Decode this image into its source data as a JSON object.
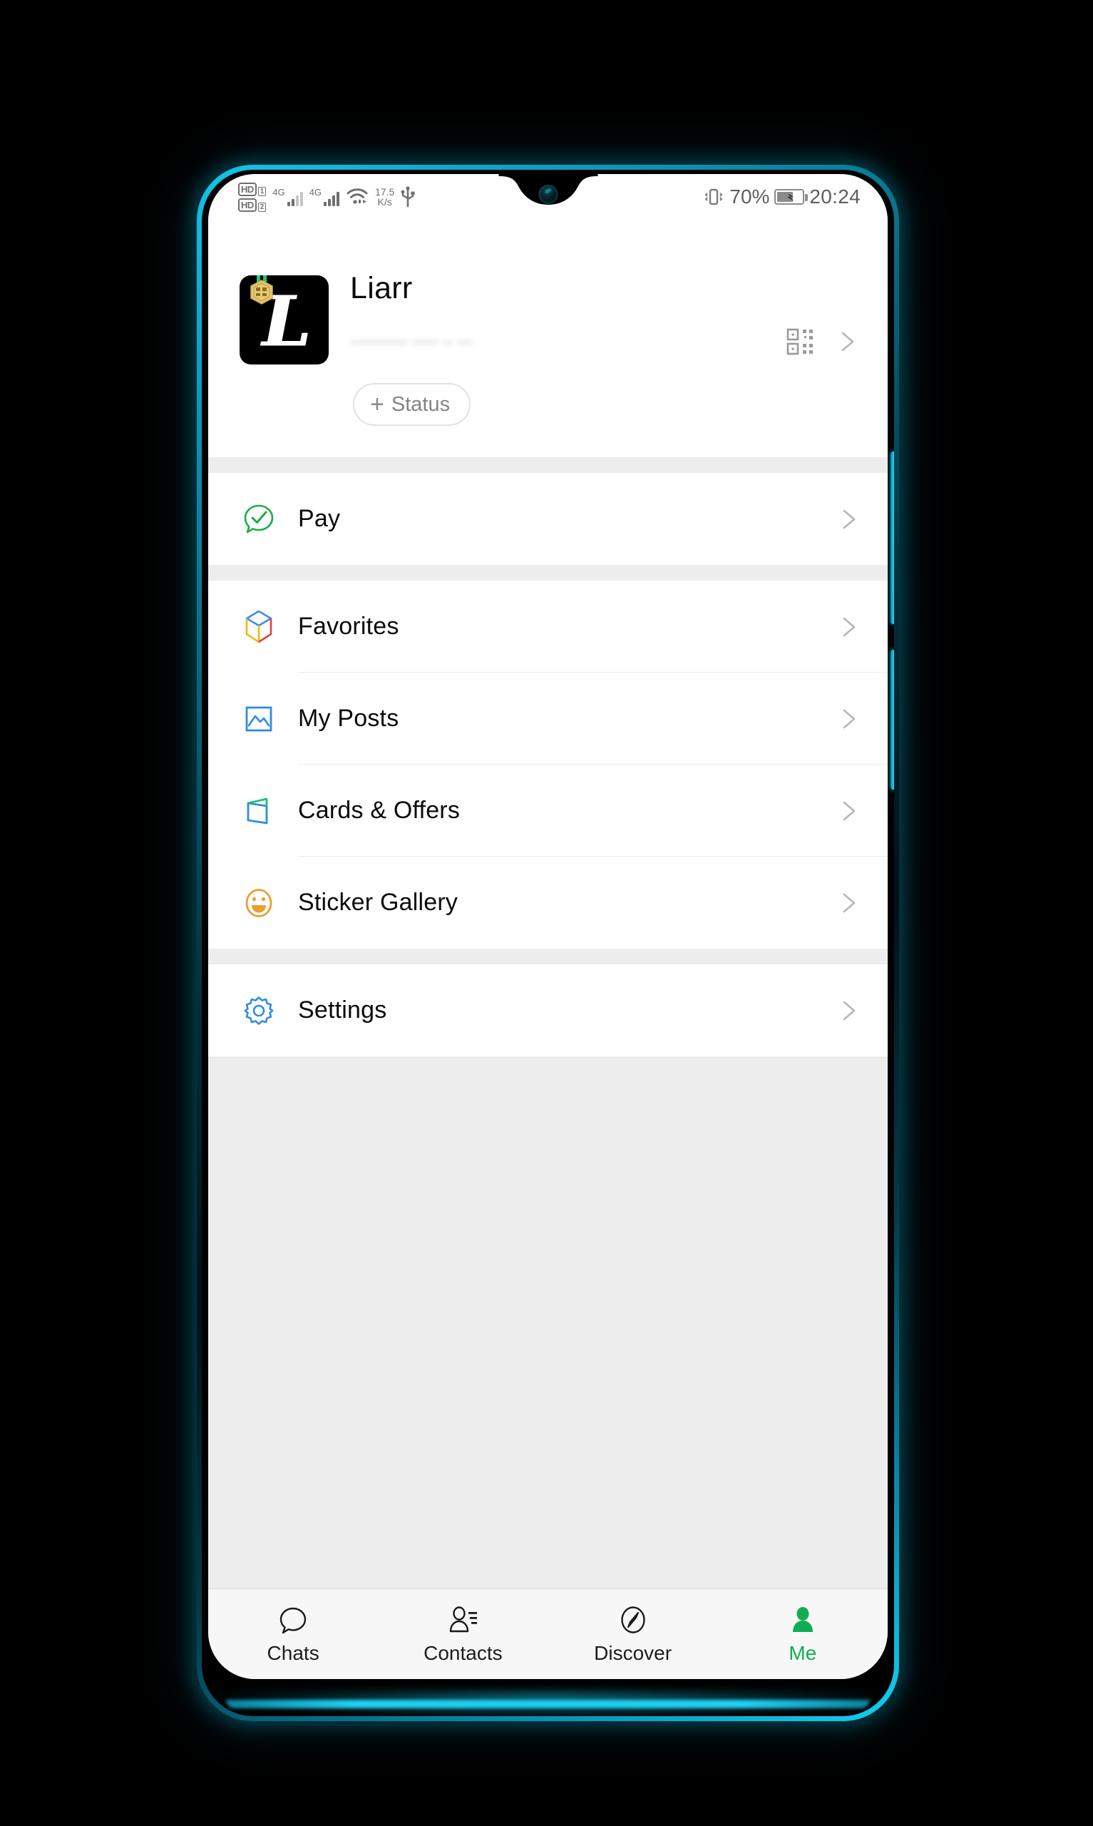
{
  "status_bar": {
    "hd1_label": "HD",
    "hd1_sim": "1",
    "hd2_label": "HD",
    "hd2_sim": "2",
    "network_1": "4G",
    "network_2": "4G",
    "wifi_icon": "wifi-icon",
    "speed_value": "17.5",
    "speed_unit": "K/s",
    "usb_icon": "usb-icon",
    "vibrate_icon": "vibrate-icon",
    "battery_percent": "70%",
    "battery_icon": "battery-charging-icon",
    "time": "20:24"
  },
  "profile": {
    "name": "Liarr",
    "avatar_letter": "L",
    "avatar_badge": "gold-medal-badge",
    "wechat_id_redacted": "•••••••••••  ••••• ••  •••",
    "qr_icon": "qr-code-icon",
    "chevron_icon": "chevron-right-icon",
    "status_button": {
      "label": "Status",
      "plus": "+"
    }
  },
  "menu_groups": [
    {
      "items": [
        {
          "label": "Pay",
          "icon": "pay-bubble-check-icon",
          "color": "#1aad4b"
        }
      ]
    },
    {
      "items": [
        {
          "label": "Favorites",
          "icon": "favorites-box-icon",
          "color": "#3b8fe0"
        },
        {
          "label": "My Posts",
          "icon": "my-posts-photo-icon",
          "color": "#2e8de0"
        },
        {
          "label": "Cards & Offers",
          "icon": "cards-wallet-icon",
          "color": "#2e8de0"
        },
        {
          "label": "Sticker Gallery",
          "icon": "sticker-smiley-icon",
          "color": "#e8a033"
        }
      ]
    },
    {
      "items": [
        {
          "label": "Settings",
          "icon": "settings-gear-icon",
          "color": "#2e8de0"
        }
      ]
    }
  ],
  "bottom_nav": {
    "items": [
      {
        "label": "Chats",
        "icon": "chat-bubble-icon",
        "active": false
      },
      {
        "label": "Contacts",
        "icon": "contacts-icon",
        "active": false
      },
      {
        "label": "Discover",
        "icon": "compass-icon",
        "active": false
      },
      {
        "label": "Me",
        "icon": "person-icon",
        "active": true
      }
    ],
    "active_color": "#10ad53"
  },
  "device": {
    "frame_accent": "#15cfef",
    "notch_type": "waterdrop-notch",
    "buttons": [
      "volume-button",
      "power-button"
    ]
  }
}
